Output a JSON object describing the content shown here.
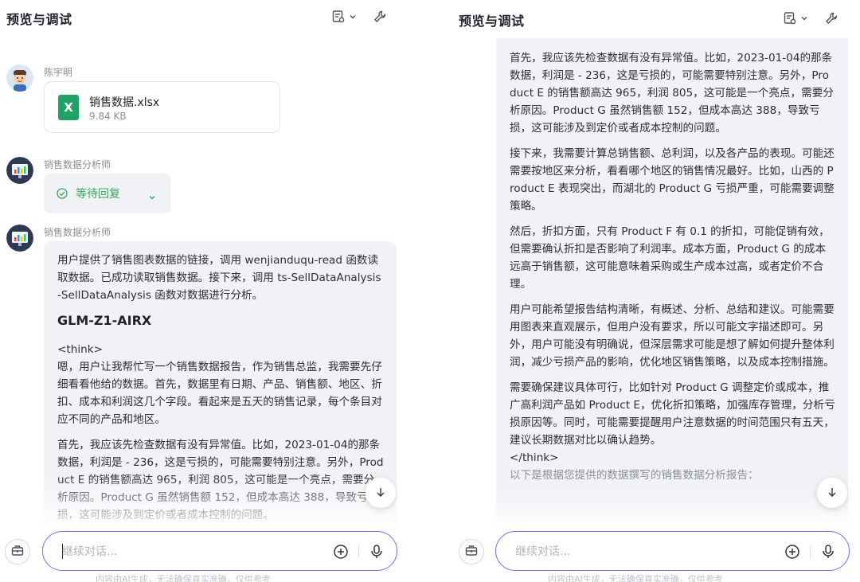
{
  "left_panel": {
    "title": "预览与调试",
    "messages": {
      "user": {
        "name": "陈宇明",
        "file": {
          "type_label": "X",
          "name": "销售数据.xlsx",
          "size": "9.84 KB"
        }
      },
      "agent_status": {
        "name": "销售数据分析师",
        "status_text": "等待回复"
      },
      "agent_reply": {
        "name": "销售数据分析师",
        "intro": "用户提供了销售图表数据的链接，调用 wenjianduqu-read 函数读取数据。已成功读取销售数据。接下来，调用 ts-SellDataAnalysis-SellDataAnalysis 函数对数据进行分析。",
        "model_name": "GLM-Z1-AIRX",
        "think_open": "<think>",
        "para1": "嗯，用户让我帮忙写一个销售数据报告，作为销售总监，我需要先仔细看看他给的数据。首先，数据里有日期、产品、销售额、地区、折扣、成本和利润这几个字段。看起来是五天的销售记录，每个条目对应不同的产品和地区。",
        "para2": "首先，我应该先检查数据有没有异常值。比如，2023-01-04的那条数据，利润是 - 236，这是亏损的，可能需要特别注意。另外，Product E 的销售额高达 965，利润 805，这可能是一个亮点，需要分析原因。Product G 虽然销售额 152，但成本高达 388，导致亏损，这可能涉及到定价或者成本控制的问题。"
      }
    },
    "input": {
      "placeholder": "继续对话..."
    },
    "footer_note": "内容由AI生成，无法确保真实准确，仅供参考"
  },
  "right_panel": {
    "title": "预览与调试",
    "paragraphs": [
      "首先，我应该先检查数据有没有异常值。比如，2023-01-04的那条数据，利润是 - 236，这是亏损的，可能需要特别注意。另外，Product E 的销售额高达 965，利润 805，这可能是一个亮点，需要分析原因。Product G 虽然销售额 152，但成本高达 388，导致亏损，这可能涉及到定价或者成本控制的问题。",
      "接下来，我需要计算总销售额、总利润，以及各产品的表现。可能还需要按地区来分析，看看哪个地区的销售情况最好。比如，山西的 Product E 表现突出，而湖北的 Product G 亏损严重，可能需要调整策略。",
      "然后，折扣方面，只有 Product F 有 0.1 的折扣，可能促销有效，但需要确认折扣是否影响了利润率。成本方面，Product G 的成本远高于销售额，这可能意味着采购或生产成本过高，或者定价不合理。",
      "用户可能希望报告结构清晰，有概述、分析、总结和建议。可能需要用图表来直观展示，但用户没有要求，所以可能文字描述即可。另外，用户可能没有明确说，但深层需求可能是想了解如何提升整体利润，减少亏损产品的影响，优化地区销售策略，以及成本控制措施。"
    ],
    "last_paragraph": "需要确保建议具体可行，比如针对 Product G 调整定价或成本，推广高利润产品如 Product E，优化折扣策略，加强库存管理，分析亏损原因等。同时，可能需要提醒用户注意数据的时间范围只有五天，建议长期数据对比以确认趋势。",
    "think_close": "</think>",
    "report_intro": "以下是根据您提供的数据撰写的销售数据分析报告：",
    "input": {
      "placeholder": "继续对话..."
    },
    "footer_note": "内容由AI生成，无法确保真实准确，仅供参考"
  },
  "colors": {
    "accent": "#7b6cf6",
    "status_green": "#3aa65c",
    "excel_green": "#21a366",
    "bubble_bg": "#f1f2f5"
  }
}
